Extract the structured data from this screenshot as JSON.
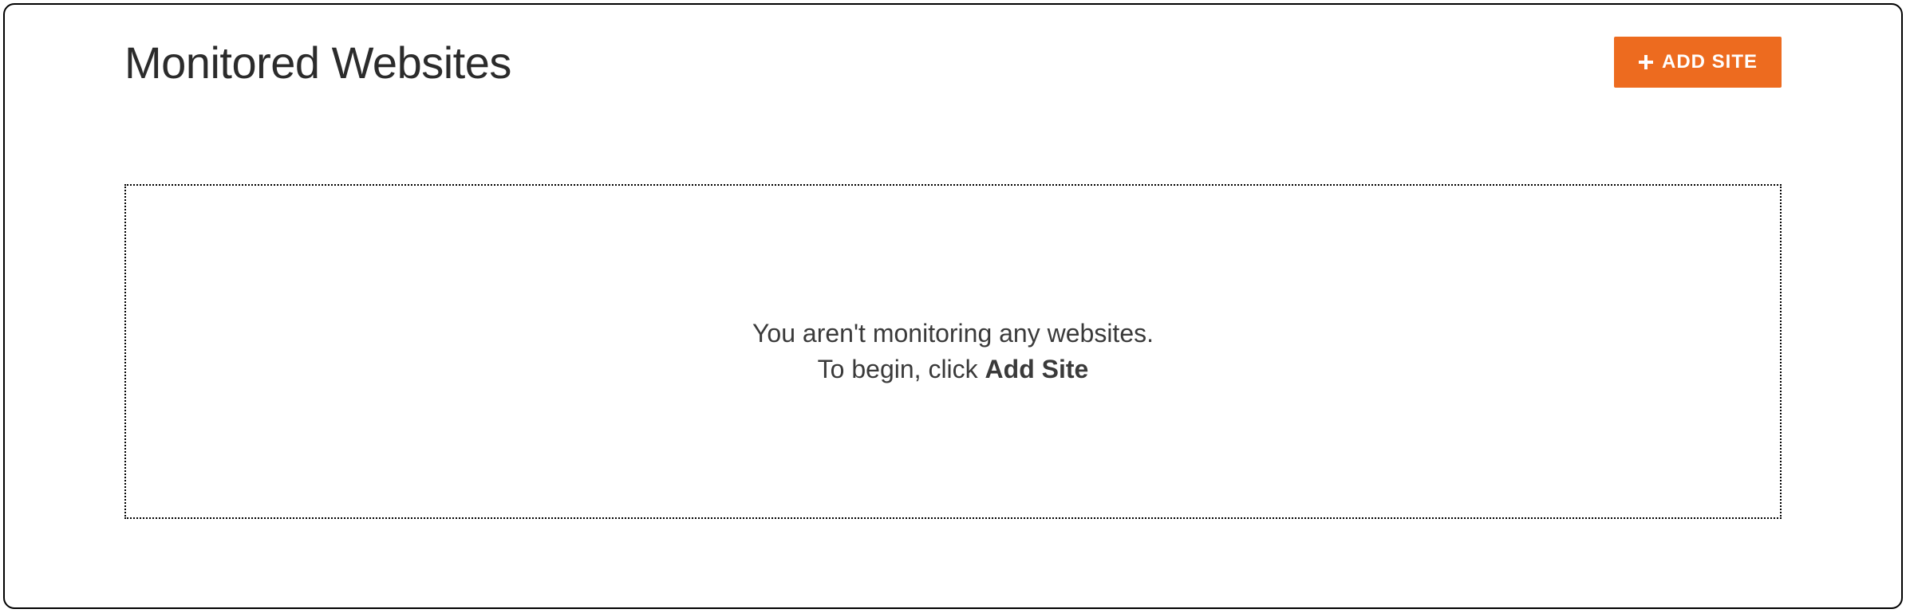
{
  "header": {
    "title": "Monitored Websites",
    "add_button_label": "ADD SITE"
  },
  "empty_state": {
    "line1": "You aren't monitoring any websites.",
    "line2_prefix": "To begin, click ",
    "line2_bold": "Add Site"
  },
  "colors": {
    "accent": "#ed6b1f"
  }
}
